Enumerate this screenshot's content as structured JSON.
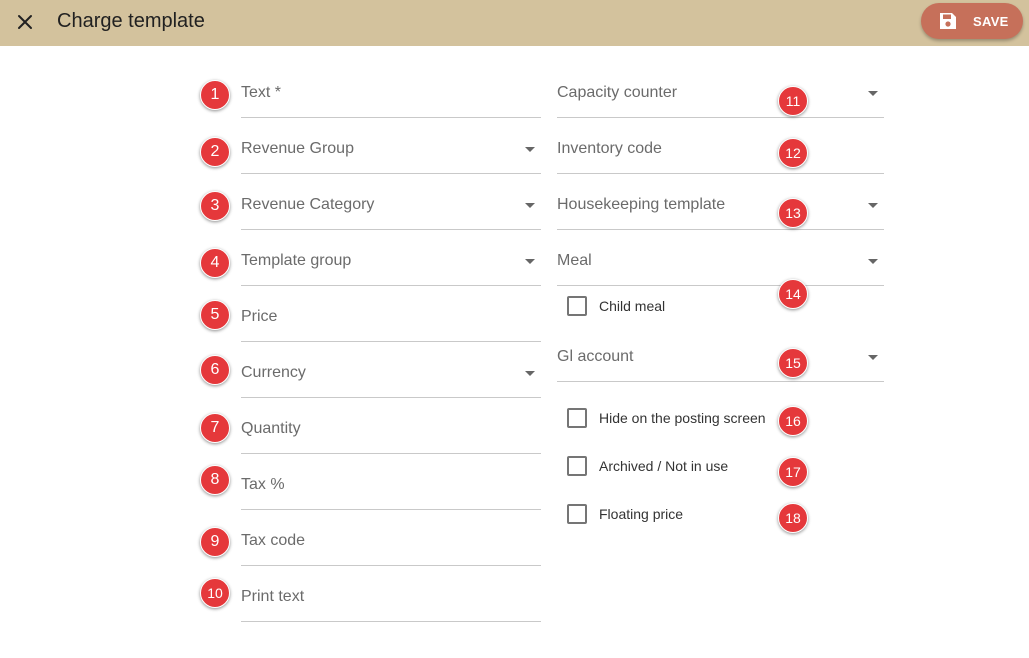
{
  "header": {
    "title": "Charge template",
    "close_icon": "close-icon",
    "save_label": "SAVE",
    "save_icon": "floppy-disk-icon",
    "bar_color": "#d3c29d",
    "save_color": "#c6705a"
  },
  "left_fields": [
    {
      "label": "Text *",
      "dropdown": false
    },
    {
      "label": "Revenue Group",
      "dropdown": true
    },
    {
      "label": "Revenue Category",
      "dropdown": true
    },
    {
      "label": "Template group",
      "dropdown": true
    },
    {
      "label": "Price",
      "dropdown": false
    },
    {
      "label": "Currency",
      "dropdown": true
    },
    {
      "label": "Quantity",
      "dropdown": false
    },
    {
      "label": "Tax %",
      "dropdown": false
    },
    {
      "label": "Tax code",
      "dropdown": false
    },
    {
      "label": "Print text",
      "dropdown": false
    }
  ],
  "right_fields": [
    {
      "label": "Capacity counter",
      "dropdown": true
    },
    {
      "label": "Inventory code",
      "dropdown": false
    },
    {
      "label": "Housekeeping template",
      "dropdown": true
    },
    {
      "label": "Meal",
      "dropdown": true
    },
    {
      "label": "Gl account",
      "dropdown": true
    }
  ],
  "checkboxes": {
    "child_meal": {
      "label": "Child meal",
      "checked": false
    },
    "hide_posting": {
      "label": "Hide on the posting screen",
      "checked": false
    },
    "archived": {
      "label": "Archived / Not in use",
      "checked": false
    },
    "floating_price": {
      "label": "Floating price",
      "checked": false
    }
  },
  "badges": [
    "1",
    "2",
    "3",
    "4",
    "5",
    "6",
    "7",
    "8",
    "9",
    "10",
    "11",
    "12",
    "13",
    "14",
    "15",
    "16",
    "17",
    "18"
  ],
  "badge_color": "#e5383b"
}
